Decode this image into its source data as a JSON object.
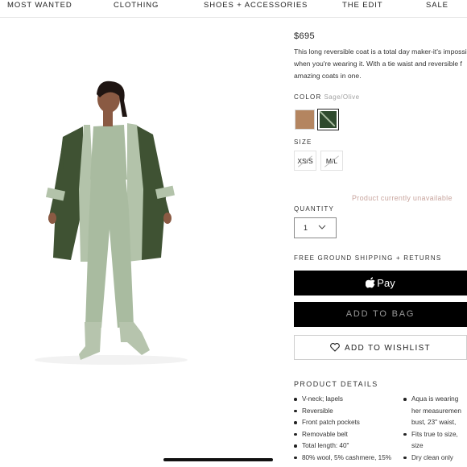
{
  "nav": {
    "items": [
      "MOST WANTED",
      "CLOTHING",
      "SHOES + ACCESSORIES",
      "THE EDIT",
      "SALE"
    ]
  },
  "product": {
    "price": "$695",
    "description": [
      "This long reversible coat is a total day maker-it's impossi",
      "when you're wearing it. With a tie waist and reversible f",
      "amazing coats in one."
    ],
    "color_label": "COLOR",
    "color_value": "Sage/Olive",
    "swatches": [
      {
        "name": "Camel",
        "hex": "#b48560",
        "selected": false
      },
      {
        "name": "Sage/Olive",
        "hex": "#2f4a2e",
        "selected": true
      }
    ],
    "size_label": "SIZE",
    "sizes": [
      "XS/S",
      "M/L"
    ],
    "unavailable_text": "Product currently unavailable",
    "quantity_label": "QUANTITY",
    "quantity_value": "1",
    "shipping_text": "FREE GROUND SHIPPING + RETURNS",
    "apple_pay_label": "Pay",
    "add_to_bag_label": "ADD TO BAG",
    "wishlist_label": "ADD TO WISHLIST",
    "details_title": "PRODUCT DETAILS",
    "details_left": [
      "V-neck; lapels",
      "Reversible",
      "Front patch pockets",
      "Removable belt",
      "Total length: 40\"",
      "80% wool, 5% cashmere, 15%"
    ],
    "details_right": [
      {
        "text": "Aqua is wearing",
        "bullet": true
      },
      {
        "text": "her measuremen",
        "bullet": false
      },
      {
        "text": "bust, 23\" waist,",
        "bullet": false
      },
      {
        "text": "Fits true to size,",
        "bullet": true
      },
      {
        "text": "size",
        "bullet": false
      },
      {
        "text": "Dry clean only",
        "bullet": true
      }
    ]
  },
  "colors": {
    "accent_black": "#000000",
    "unavailable": "#c9a69f",
    "coat_olive": "#3f5233",
    "sage": "#a9bba0"
  },
  "icons": [
    "apple-icon",
    "heart-icon",
    "chevron-down-icon"
  ]
}
